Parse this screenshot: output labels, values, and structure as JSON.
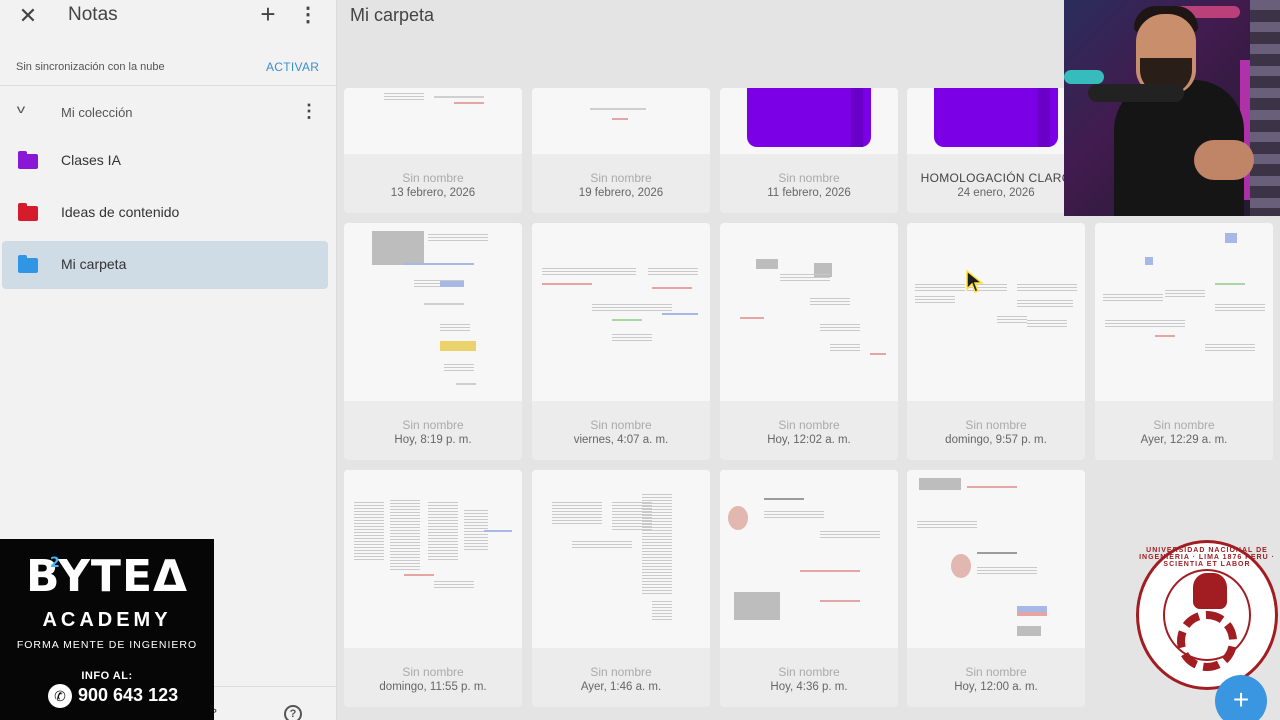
{
  "sidebar": {
    "title": "Notas",
    "sync_text": "Sin sincronización con la nube",
    "sync_button": "ACTIVAR",
    "collection_label": "Mi colección",
    "folders": [
      {
        "label": "Clases IA",
        "color": "#8a16d6"
      },
      {
        "label": "Ideas de contenido",
        "color": "#d61c2a"
      },
      {
        "label": "Mi carpeta",
        "color": "#2f96e6"
      }
    ],
    "footer_glyph": "ꝭ"
  },
  "main": {
    "title": "Mi carpeta",
    "row1": [
      {
        "name": "Sin nombre",
        "date": "13 febrero, 2026"
      },
      {
        "name": "Sin nombre",
        "date": "19 febrero, 2026"
      },
      {
        "name": "Sin nombre",
        "date": "11 febrero, 2026"
      },
      {
        "name": "HOMOLOGACIÓN CLARO",
        "date": "24 enero, 2026"
      }
    ],
    "row2": [
      {
        "name": "Sin nombre",
        "date": "Hoy, 8:19 p. m."
      },
      {
        "name": "Sin nombre",
        "date": "viernes, 4:07 a. m."
      },
      {
        "name": "Sin nombre",
        "date": "Hoy, 12:02 a. m."
      },
      {
        "name": "Sin nombre",
        "date": "domingo, 9:57 p. m."
      },
      {
        "name": "Sin nombre",
        "date": "Ayer, 12:29 a. m."
      }
    ],
    "row3": [
      {
        "name": "Sin nombre",
        "date": "domingo, 11:55 p. m."
      },
      {
        "name": "Sin nombre",
        "date": "Ayer, 1:46 a. m."
      },
      {
        "name": "Sin nombre",
        "date": "Hoy, 4:36 p. m."
      },
      {
        "name": "Sin nombre",
        "date": "Hoy, 12:00 a. m."
      }
    ]
  },
  "brand": {
    "logo": "BYTEΔ",
    "logo_superscript": "2",
    "academy": "ACADEMY",
    "tagline": "FORMA MENTE DE INGENIERO",
    "info_label": "INFO AL:",
    "phone": "900 643 123"
  },
  "seal": {
    "text": "UNIVERSIDAD NACIONAL DE INGENIERIA · LIMA 1876 PERU · SCIENTIA ET LABOR"
  },
  "icons": {
    "close": "close-icon",
    "add": "add-icon",
    "more": "more-vert-icon",
    "chevron": "chevron-down-icon",
    "folder": "folder-icon",
    "help": "help-icon",
    "whatsapp": "whatsapp-icon"
  }
}
